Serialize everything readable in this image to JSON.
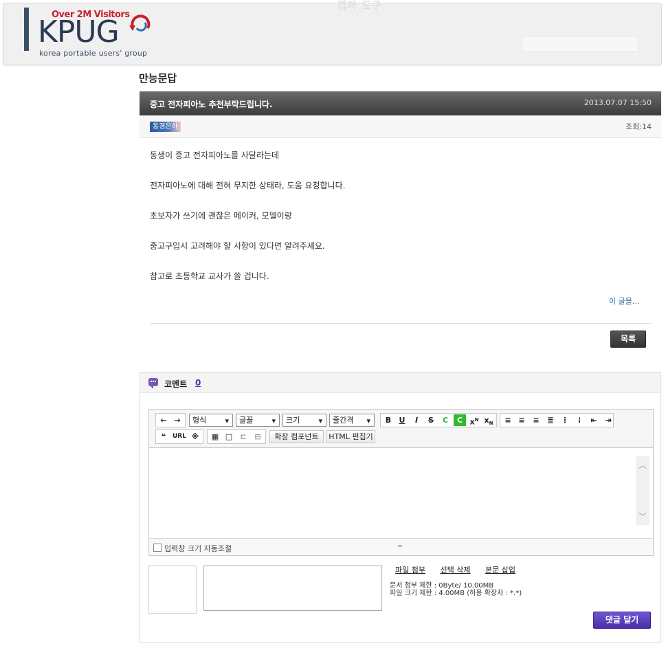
{
  "header": {
    "logo_visitors": "Over 2M Visitors",
    "logo_text": "KPUG",
    "logo_sub": "korea portable users' group",
    "capture_label": "캡처 도구"
  },
  "board": {
    "title": "만능문답"
  },
  "post": {
    "title": "중고 전자피아노 추천부탁드립니다.",
    "date": "2013.07.07 15:50",
    "author": "동경은하",
    "views": "조회:14",
    "body": [
      "동생이 중고 전자피아노를 사달라는데",
      "전자피아노에 대해 전혀 무지한 상태라, 도움 요청합니다.",
      "초보자가 쓰기에 괜찮은 메이커, 모델이랑",
      "중고구입시 고려해야 할 사항이 있다면 알려주세요.",
      "참고로 초등학교 교사가 쓸 겁니다."
    ],
    "this_post_link": "이 글을...",
    "list_button": "목록"
  },
  "comments": {
    "label": "코멘트",
    "count": "0",
    "toolbar": {
      "format": "형식",
      "font": "글꼴",
      "size": "크기",
      "line_height": "줄간격",
      "url": "URL",
      "ext_component": "확장 컴포넌트",
      "html_editor": "HTML 편집기"
    },
    "auto_resize_label": "입력창 크기 자동조절",
    "file_attach": "파일 첨부",
    "delete_selected": "선택 삭제",
    "insert_body": "본문 삽입",
    "doc_limit": "문서 첨부 제한 : 0Byte/ 10.00MB",
    "file_limit": "파일 크기 제한 : 4.00MB (허용 확장자 : *.*)",
    "submit": "댓글 달기"
  }
}
